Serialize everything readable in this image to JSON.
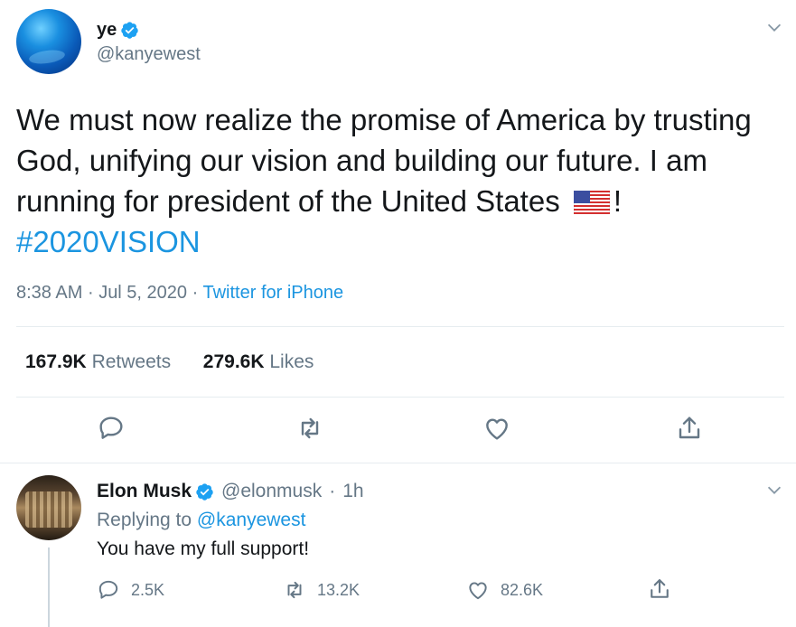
{
  "tweet": {
    "author_name": "ye",
    "author_handle": "@kanyewest",
    "text_before_flag": "We must now realize the promise of America by trusting God, unifying our vision and building our future. I am running for president of the United States",
    "text_after_flag": "!",
    "hashtag": "#2020VISION",
    "time": "8:38 AM",
    "date": "Jul 5, 2020",
    "separator": "·",
    "source": "Twitter for iPhone",
    "retweets_count": "167.9K",
    "retweets_label": "Retweets",
    "likes_count": "279.6K",
    "likes_label": "Likes"
  },
  "reply": {
    "author_name": "Elon Musk",
    "author_handle": "@elonmusk",
    "separator": "·",
    "age": "1h",
    "replying_to_label": "Replying to",
    "replying_to_handle": "@kanyewest",
    "text": "You have my full support!",
    "reply_count": "2.5K",
    "retweet_count": "13.2K",
    "like_count": "82.6K"
  },
  "colors": {
    "accent": "#1b95e0",
    "secondary_text": "#657786",
    "primary_text": "#14171a",
    "divider": "#e6ecf0"
  },
  "icons": [
    "verified-badge-icon",
    "chevron-down-icon",
    "reply-icon",
    "retweet-icon",
    "like-icon",
    "share-icon",
    "us-flag-emoji"
  ]
}
